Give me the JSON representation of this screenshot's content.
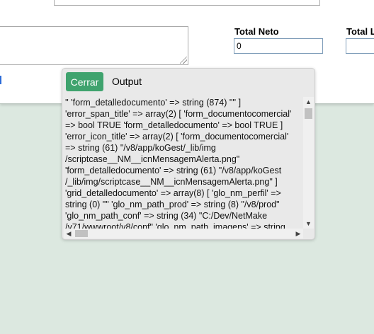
{
  "form": {
    "total_neto": {
      "label": "Total Neto",
      "value": "0"
    },
    "total_l": {
      "label": "Total L",
      "value": ""
    }
  },
  "output_panel": {
    "close_label": "Cerrar",
    "title": "Output",
    "lines": [
      "'' 'form_detalledocumento' => string (874) \"'' ]",
      "'error_span_title' => array(2) [ 'form_documentocomercial'",
      "=> bool TRUE 'form_detalledocumento' => bool TRUE ]",
      "'error_icon_title' => array(2) [ 'form_documentocomercial'",
      "=> string (61) \"/v8/app/koGest/_lib/img",
      "/scriptcase__NM__icnMensagemAlerta.png\"",
      "'form_detalledocumento' => string (61) \"/v8/app/koGest",
      "/_lib/img/scriptcase__NM__icnMensagemAlerta.png\" ]",
      "'grid_detalledocumento' => array(8) [ 'glo_nm_perfil' =>",
      "string (0) \"\" 'glo_nm_path_prod' => string (8) \"/v8/prod\"",
      "'glo_nm_path_conf' => string (34) \"C:/Dev/NetMake",
      "/v71/wwwroot/v8/conf\" 'glo_nm_path_imagens' => string"
    ],
    "scroll_up_icon": "chevron-up-icon",
    "scroll_down_icon": "chevron-down-icon",
    "scroll_left_icon": "chevron-left-icon",
    "scroll_right_icon": "chevron-right-icon"
  }
}
